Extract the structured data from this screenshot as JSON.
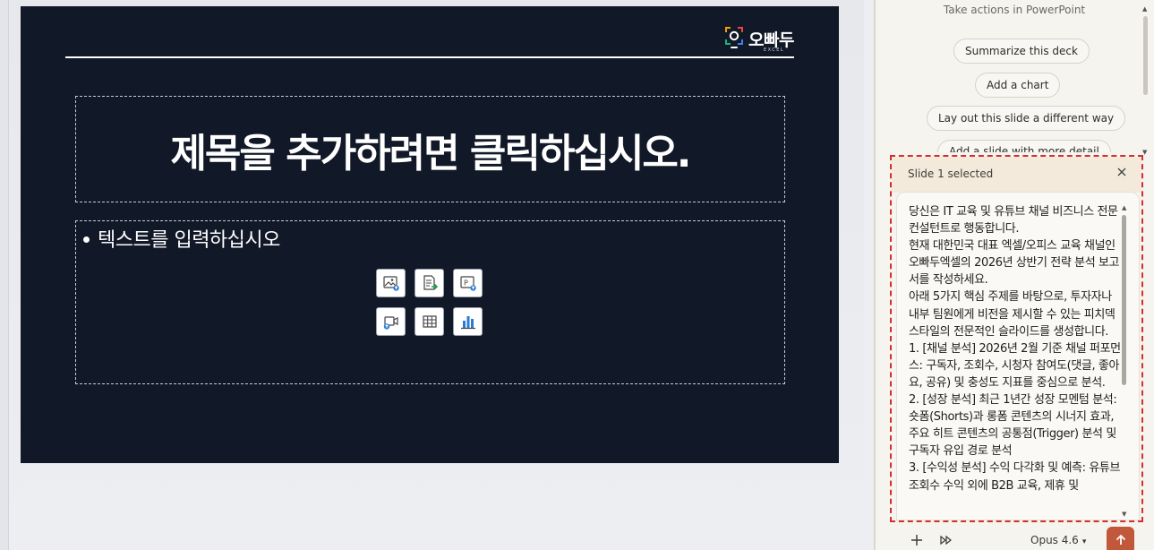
{
  "slide": {
    "logo": {
      "text": "오빠두",
      "subtext": "EXCEL"
    },
    "title_placeholder": "제목을 추가하려면 클릭하십시오.",
    "body_placeholder": "텍스트를 입력하십시오",
    "insert_icons": [
      "insert-picture-icon",
      "insert-file-icon",
      "insert-pptx-icon",
      "insert-video-icon",
      "insert-table-icon",
      "insert-chart-icon"
    ]
  },
  "panel": {
    "actions_heading": "Take actions in PowerPoint",
    "suggestions": [
      "Summarize this deck",
      "Add a chart",
      "Lay out this slide a different way",
      "Add a slide with more detail"
    ],
    "selection_label": "Slide 1 selected",
    "prompt_text": "당신은 IT 교육 및 유튜브 채널 비즈니스 전문 컨설턴트로 행동합니다.\n현재 대한민국 대표 엑셀/오피스 교육 채널인 오빠두엑셀의 2026년 상반기 전략 분석 보고서를 작성하세요.\n아래 5가지 핵심 주제를 바탕으로, 투자자나 내부 팀원에게 비전을 제시할 수 있는 피치덱 스타일의 전문적인 슬라이드를 생성합니다.\n1. [채널 분석] 2026년 2월 기준 채널 퍼포먼스: 구독자, 조회수, 시청자 참여도(댓글, 좋아요, 공유) 및 충성도 지표를 중심으로 분석.\n2. [성장 분석] 최근 1년간 성장 모멘텀 분석: 숏폼(Shorts)과 롱폼 콘텐츠의 시너지 효과, 주요 히트 콘텐츠의 공통점(Trigger) 분석 및 구독자 유입 경로 분석\n3. [수익성 분석] 수익 다각화 및 예측: 유튜브 조회수 수익 외에 B2B 교육, 제휴 및",
    "model_label": "Opus 4.6",
    "colors": {
      "accent": "#c1573b",
      "selection": "#d32f2f",
      "slide_bg": "#111827"
    }
  }
}
